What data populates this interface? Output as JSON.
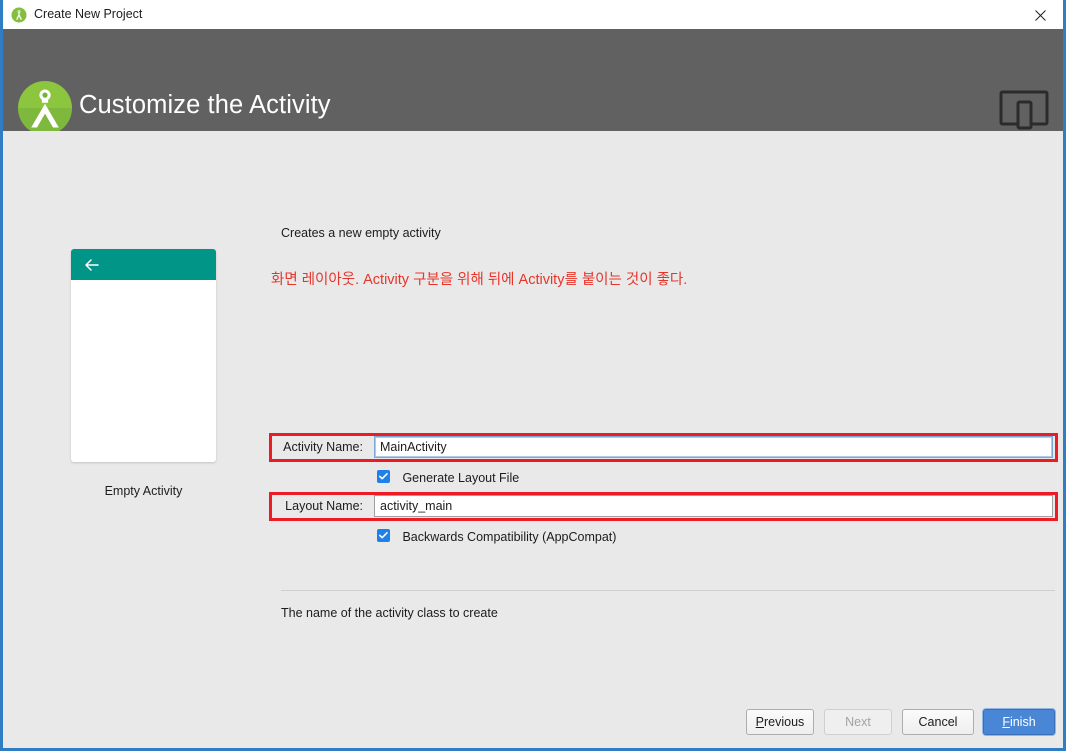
{
  "window": {
    "title": "Create New Project",
    "app_icon": "android-studio-icon",
    "close_icon": "close-icon",
    "border_color": "#2f7ec4"
  },
  "header": {
    "title": "Customize the Activity",
    "logo_icon": "android-studio-logo",
    "device_icon": "tablet-phone-icon",
    "background_color": "#616161"
  },
  "preview": {
    "caption": "Empty Activity",
    "appbar_color": "#009587",
    "back_icon": "arrow-left-icon"
  },
  "main": {
    "description": "Creates a new empty activity",
    "annotation_note": "화면 레이아웃. Activity 구분을 위해 뒤에 Activity를 붙이는 것이 좋다.",
    "annotation_color": "#e8352a",
    "highlight_box_color": "#ed1c24",
    "help_text": "The name of the activity class to create",
    "fields": [
      {
        "label": "Activity Name:",
        "value": "MainActivity",
        "focused": true
      },
      {
        "label": "Layout Name:",
        "value": "activity_main",
        "focused": false
      }
    ],
    "checkboxes": [
      {
        "label": "Generate Layout File",
        "checked": true
      },
      {
        "label": "Backwards Compatibility (AppCompat)",
        "checked": true
      }
    ],
    "checkbox_color": "#1e80e8"
  },
  "footer": {
    "buttons": [
      {
        "label": "Previous",
        "mnemonic": "P",
        "state": "enabled"
      },
      {
        "label": "Next",
        "mnemonic": "N",
        "state": "disabled"
      },
      {
        "label": "Cancel",
        "mnemonic": "",
        "state": "enabled"
      },
      {
        "label": "Finish",
        "mnemonic": "F",
        "state": "default"
      }
    ],
    "primary_color": "#4a86d6"
  }
}
